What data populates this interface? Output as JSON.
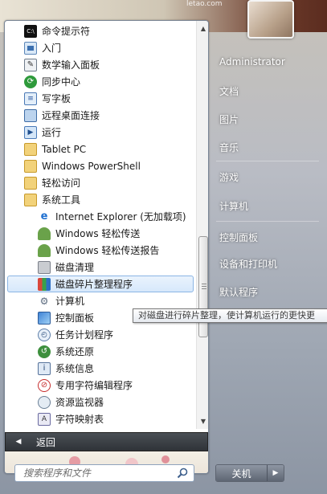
{
  "watermark": "letao.com",
  "programs": [
    {
      "label": "命令提示符",
      "icon": "cmd-icon"
    },
    {
      "label": "入门",
      "icon": "getting-started-icon"
    },
    {
      "label": "数学输入面板",
      "icon": "math-input-icon"
    },
    {
      "label": "同步中心",
      "icon": "sync-center-icon"
    },
    {
      "label": "写字板",
      "icon": "wordpad-icon"
    },
    {
      "label": "远程桌面连接",
      "icon": "remote-desktop-icon"
    },
    {
      "label": "运行",
      "icon": "run-icon"
    },
    {
      "label": "Tablet PC",
      "icon": "folder-icon"
    },
    {
      "label": "Windows PowerShell",
      "icon": "folder-icon"
    },
    {
      "label": "轻松访问",
      "icon": "folder-icon"
    },
    {
      "label": "系统工具",
      "icon": "folder-icon"
    },
    {
      "label": "Internet Explorer (无加载项)",
      "icon": "internet-explorer-icon"
    },
    {
      "label": "Windows 轻松传送",
      "icon": "easy-transfer-icon"
    },
    {
      "label": "Windows 轻松传送报告",
      "icon": "easy-transfer-reports-icon"
    },
    {
      "label": "磁盘清理",
      "icon": "disk-cleanup-icon"
    },
    {
      "label": "磁盘碎片整理程序",
      "icon": "disk-defragmenter-icon"
    },
    {
      "label": "计算机",
      "icon": "computer-icon"
    },
    {
      "label": "控制面板",
      "icon": "control-panel-icon"
    },
    {
      "label": "任务计划程序",
      "icon": "task-scheduler-icon"
    },
    {
      "label": "系统还原",
      "icon": "system-restore-icon"
    },
    {
      "label": "系统信息",
      "icon": "system-information-icon"
    },
    {
      "label": "专用字符编辑程序",
      "icon": "private-character-editor-icon"
    },
    {
      "label": "资源监视器",
      "icon": "resource-monitor-icon"
    },
    {
      "label": "字符映射表",
      "icon": "character-map-icon"
    }
  ],
  "selected_index": 15,
  "tooltip": "对磁盘进行碎片整理，使计算机运行的更快更",
  "back_label": "返回",
  "search": {
    "placeholder": "搜索程序和文件"
  },
  "right_pane": {
    "items": [
      "Administrator",
      "文档",
      "图片",
      "音乐",
      "游戏",
      "计算机",
      "控制面板",
      "设备和打印机",
      "默认程序"
    ]
  },
  "shutdown": {
    "label": "关机"
  },
  "colors": {
    "selection": "#d7e8fb",
    "selection_border": "#8bb5e4",
    "back_bar": "#3a3e44"
  }
}
